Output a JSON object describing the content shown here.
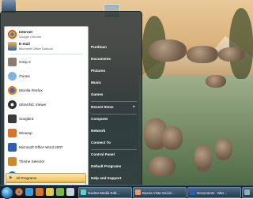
{
  "start_menu": {
    "pinned": [
      {
        "title": "Internet",
        "subtitle": "Google Chrome",
        "icon": "chrome-icon",
        "color": "#d9412b"
      },
      {
        "title": "E-mail",
        "subtitle": "Microsoft Office Outlook",
        "icon": "outlook-icon",
        "color": "#2b63b5"
      }
    ],
    "recent": [
      {
        "label": "Gimp 2",
        "icon": "gimp-icon",
        "color": "#8b7d6b"
      },
      {
        "label": "iTunes",
        "icon": "itunes-icon",
        "color": "#7fb3de"
      },
      {
        "label": "Mozilla Firefox",
        "icon": "firefox-icon",
        "color": "#e07a1e"
      },
      {
        "label": "UltraVNC Viewer",
        "icon": "vnc-icon",
        "color": "#2f2f2f"
      },
      {
        "label": "Songbird",
        "icon": "songbird-icon",
        "color": "#3a3a3a"
      },
      {
        "label": "Winamp",
        "icon": "winamp-icon",
        "color": "#d8732a"
      },
      {
        "label": "Microsoft Office Word 2007",
        "icon": "word-icon",
        "color": "#2d5fb1"
      },
      {
        "label": "Theme Selector",
        "icon": "theme-icon",
        "color": "#c98b2b"
      },
      {
        "label": "CDBurnerXP",
        "icon": "cdburner-icon",
        "color": "#1f73b8"
      }
    ],
    "all_programs": "All Programs",
    "right": [
      {
        "label": "Purdman",
        "name": "user-folder"
      },
      {
        "label": "Documents",
        "name": "documents"
      },
      {
        "label": "Pictures",
        "name": "pictures"
      },
      {
        "label": "Music",
        "name": "music"
      },
      {
        "label": "Games",
        "name": "games"
      },
      {
        "label": "Recent Items",
        "name": "recent-items"
      },
      {
        "label": "Computer",
        "name": "computer"
      },
      {
        "label": "Network",
        "name": "network"
      },
      {
        "label": "Connect To",
        "name": "connect-to"
      },
      {
        "label": "Control Panel",
        "name": "control-panel"
      },
      {
        "label": "Default Programs",
        "name": "default-programs"
      },
      {
        "label": "Help and Support",
        "name": "help-and-support"
      }
    ]
  },
  "taskbar": {
    "tasks": [
      {
        "label": "Gavitar Media Edit...",
        "icon": "media-icon",
        "color": "#6cc"
      },
      {
        "label": "Buena Vista Social ...",
        "icon": "music-icon",
        "color": "#e96"
      },
      {
        "label": "Document1 - Micr...",
        "icon": "word-icon",
        "color": "#2d5fb1"
      },
      {
        "label": "Moon - Mi...",
        "icon": "app-icon",
        "color": "#9ab"
      }
    ]
  }
}
